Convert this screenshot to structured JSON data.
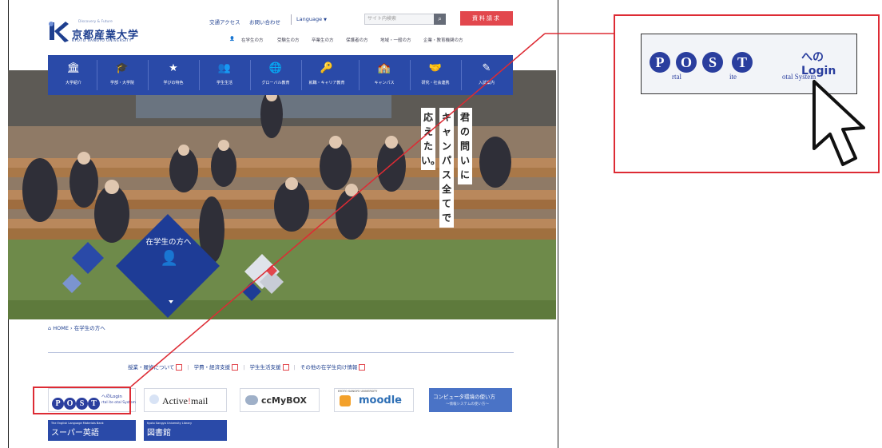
{
  "header": {
    "logo_tagline": "Discovery & Future",
    "logo_name": "京都産業大学",
    "logo_subtitle": "KYOTO SANGYO UNIVERSITY",
    "access_link": "交通アクセス",
    "contact_link": "お問い合わせ",
    "language_label": "Language",
    "search_placeholder": "サイト内検索",
    "request_button": "資料請求",
    "audience_links": [
      "在学生の方",
      "受験生の方",
      "卒業生の方",
      "保護者の方",
      "地域・一般の方",
      "企業・教育機関の方"
    ]
  },
  "nav": {
    "items": [
      {
        "label": "大学紹介",
        "icon": "🏛"
      },
      {
        "label": "学部・大学院",
        "icon": "🎓"
      },
      {
        "label": "学びの特色",
        "icon": "★"
      },
      {
        "label": "学生生活",
        "icon": "👥"
      },
      {
        "label": "グローバル教育",
        "icon": "🌐"
      },
      {
        "label": "就職・キャリア教育",
        "icon": "🔑"
      },
      {
        "label": "キャンパス",
        "icon": "🏫"
      },
      {
        "label": "研究・社会連携",
        "icon": "🤝"
      },
      {
        "label": "入試案内",
        "icon": "✎"
      }
    ]
  },
  "hero": {
    "caption": "在学生の方へ",
    "vertical_text": [
      "君の問いに",
      "キャンパス全てで",
      "応えたい。"
    ]
  },
  "breadcrumb": {
    "home": "HOME",
    "current": "在学生の方へ"
  },
  "sublinks": [
    "授業・履修について",
    "学費・経済支援",
    "学生生活支援",
    "その他の在学生向け情報"
  ],
  "banners": {
    "post_letters": [
      "P",
      "O",
      "S",
      "T"
    ],
    "post_login": "へのLogin",
    "post_subwords": [
      "rtal",
      "ite",
      "otal System"
    ],
    "activemail_a": "Active",
    "activemail_b": "mail",
    "ccmybox": "ccMyBOX",
    "moodle_top": "KYOTO SANGYO UNIVERSITY",
    "moodle": "moodle",
    "computer_usage": "コンピュータ環境の使い方",
    "computer_usage_sub": "〜情報システムの使い方〜",
    "super_eigo_small": "The English Language Materials Bank",
    "super_eigo": "スーパー英語",
    "library_small": "Kyoto Sangyo University Library",
    "library": "図書館"
  },
  "callout": {
    "letters": [
      "P",
      "O",
      "S",
      "T"
    ],
    "login": "へのLogin",
    "subwords": [
      "rtal",
      "ite",
      "otal System"
    ]
  },
  "colors": {
    "brand_blue": "#2a4aa8",
    "accent_red": "#dd2b34",
    "request_red": "#e2474d"
  }
}
